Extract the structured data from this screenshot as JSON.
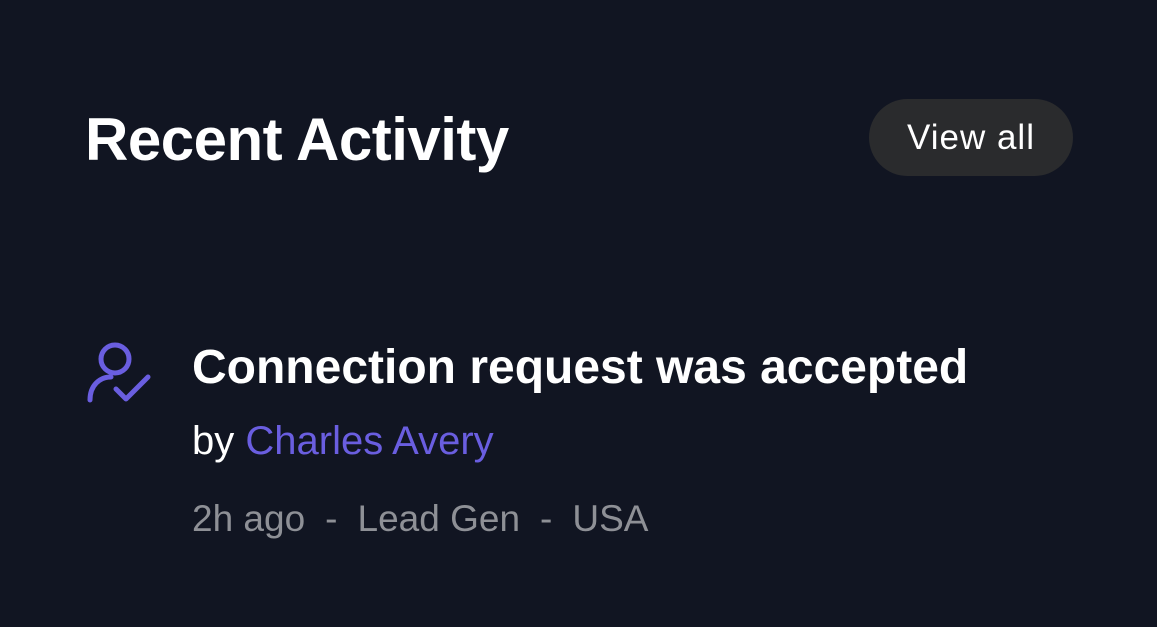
{
  "header": {
    "title": "Recent Activity",
    "view_all_label": "View all"
  },
  "activity": [
    {
      "icon": "user-check-icon",
      "title": "Connection request was accepted",
      "by_prefix": "by",
      "author": "Charles Avery",
      "time": "2h ago",
      "separator": "-",
      "campaign": "Lead Gen",
      "location": "USA"
    }
  ],
  "colors": {
    "background": "#111522",
    "accent": "#6a5ee0",
    "button_bg": "#2a2b2d",
    "muted_text": "#8e9096"
  }
}
